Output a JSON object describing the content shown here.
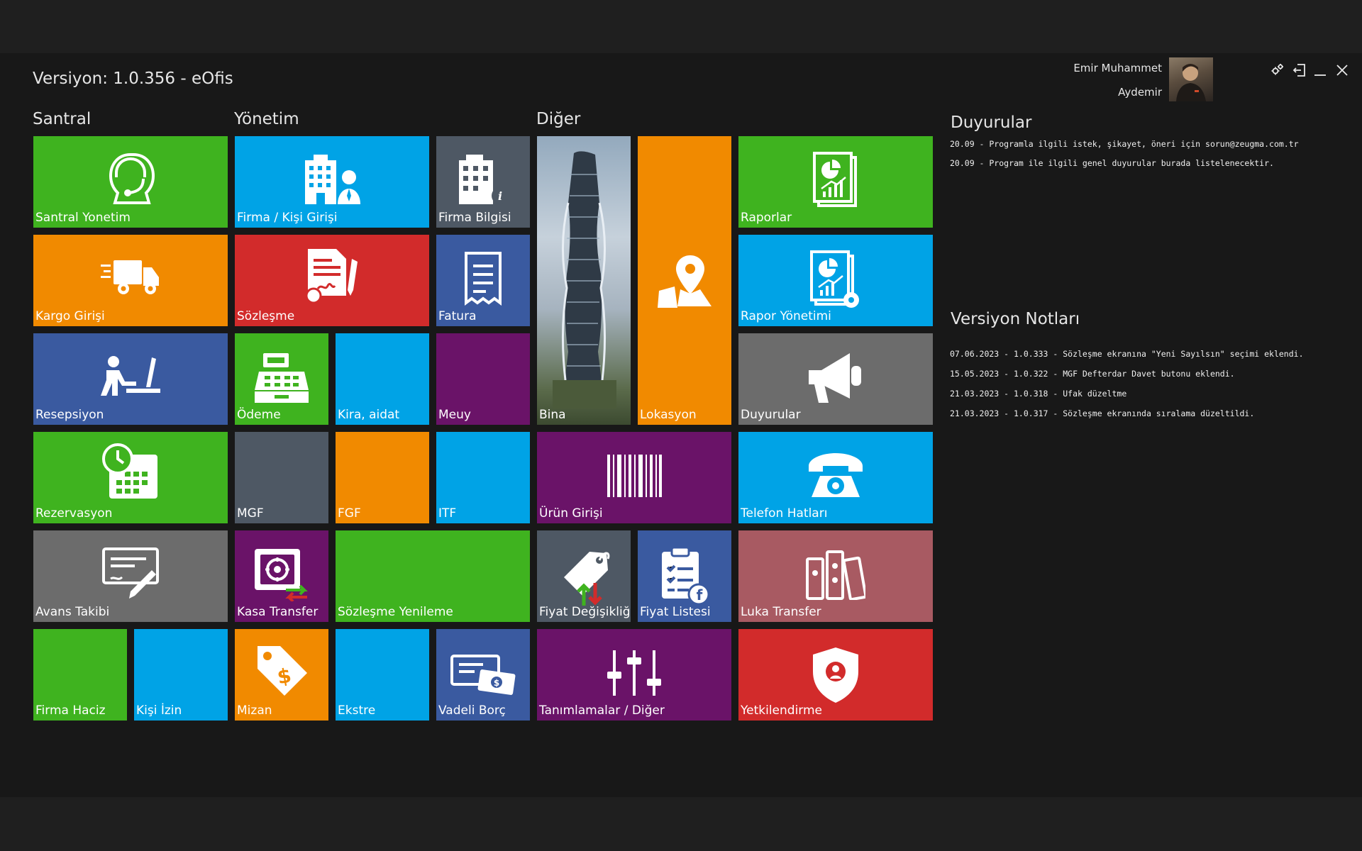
{
  "app": {
    "title": "Versiyon: 1.0.356 - eOfis"
  },
  "user": {
    "first_name": "Emir Muhammet",
    "last_name": "Aydemir"
  },
  "groups": {
    "santral": "Santral",
    "yonetim": "Yönetim",
    "diger": "Diğer"
  },
  "tiles": {
    "santral_yonetim": "Santral Yonetim",
    "kargo_girisi": "Kargo Girişi",
    "resepsiyon": "Resepsiyon",
    "rezervasyon": "Rezervasyon",
    "avans_takibi": "Avans Takibi",
    "firma_haciz": "Firma Haciz",
    "kisi_izin": "Kişi İzin",
    "firma_kisi_girisi": "Firma / Kişi Girişi",
    "firma_bilgisi": "Firma Bilgisi",
    "sozlesme": "Sözleşme",
    "fatura": "Fatura",
    "odeme": "Ödeme",
    "kira_aidat": "Kira, aidat",
    "meuy": "Meuy",
    "mgf": "MGF",
    "fgf": "FGF",
    "itf": "ITF",
    "kasa_transfer": "Kasa Transfer",
    "sozlesme_yenileme": "Sözleşme Yenileme",
    "mizan": "Mizan",
    "ekstre": "Ekstre",
    "vadeli_borc": "Vadeli Borç",
    "bina": "Bina",
    "lokasyon": "Lokasyon",
    "raporlar": "Raporlar",
    "rapor_yonetimi": "Rapor Yönetimi",
    "duyurular": "Duyurular",
    "urun_girisi": "Ürün Girişi",
    "telefon_hatlari": "Telefon Hatları",
    "fiyat_degisikligi": "Fiyat Değişikliği",
    "fiyat_listesi": "Fiyat Listesi",
    "luka_transfer": "Luka Transfer",
    "tanimlamalar": "Tanımlamalar / Diğer",
    "yetkilendirme": "Yetkilendirme"
  },
  "announcements": {
    "title": "Duyurular",
    "items": [
      "20.09 - Programla ilgili istek, şikayet, öneri için sorun@zeugma.com.tr",
      "20.09 - Program ile ilgili genel duyurular burada listelenecektir."
    ]
  },
  "release_notes": {
    "title": "Versiyon Notları",
    "items": [
      "07.06.2023 - 1.0.333 - Sözleşme ekranına \"Yeni Sayılsın\" seçimi eklendi.",
      "15.05.2023 - 1.0.322 - MGF Defterdar Davet butonu eklendi.",
      "21.03.2023 - 1.0.318 - Ufak düzeltme",
      "21.03.2023 - 1.0.317 - Sözleşme ekranında sıralama düzeltildi."
    ]
  },
  "window_controls": [
    "settings-icon",
    "logout-icon",
    "minimize-icon",
    "close-icon"
  ],
  "colors": {
    "green": "#3fb31f",
    "orange": "#f18a00",
    "blue": "#00a3e6",
    "red": "#d22b2b",
    "navy": "#3a5aa0",
    "slate": "#4e5864",
    "purple": "#6a1368",
    "gray": "#6c6c6c",
    "rose": "#a85a62",
    "background": "#181818"
  }
}
